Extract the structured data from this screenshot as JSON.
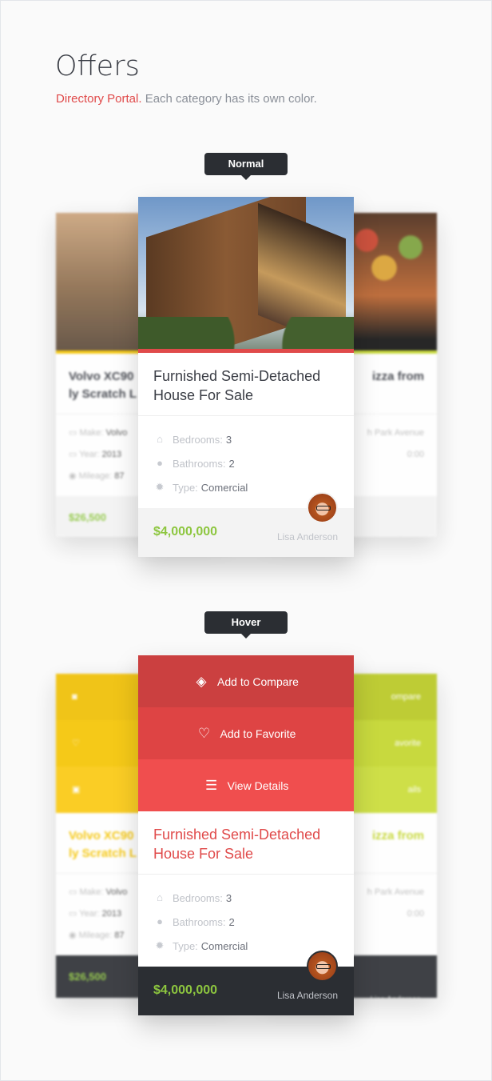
{
  "header": {
    "title": "Offers",
    "subtitle_accent": "Directory Portal.",
    "subtitle_rest": " Each category has its own color."
  },
  "states": {
    "normal": "Normal",
    "hover": "Hover"
  },
  "colors": {
    "real_estate": "#e04a4a",
    "cars": "#f5c400",
    "food": "#c3d62a",
    "price": "#8dc63f",
    "dark": "#2b2e33"
  },
  "left_card": {
    "title_line1": "Volvo XC90",
    "title_line2": "ly Scratch L",
    "features": [
      {
        "label": "Make:",
        "value": "Volvo"
      },
      {
        "label": "Year:",
        "value": "2013"
      },
      {
        "label": "Mileage:",
        "value": "87"
      }
    ],
    "price": "$26,500"
  },
  "right_card": {
    "title": "izza from",
    "features": [
      {
        "value": "h Park Avenue"
      },
      {
        "value": "0:00"
      }
    ],
    "author": "Lisa Anderson",
    "hover_actions": [
      "ompare",
      "avorite",
      "ails"
    ]
  },
  "main_card": {
    "title": "Furnished Semi-Detached House For Sale",
    "features": [
      {
        "icon": "home-icon",
        "label": "Bedrooms:",
        "value": "3"
      },
      {
        "icon": "drop-icon",
        "label": "Bathrooms:",
        "value": "2"
      },
      {
        "icon": "gear-icon",
        "label": "Type:",
        "value": "Comercial"
      }
    ],
    "price": "$4,000,000",
    "author": "Lisa Anderson",
    "hover_actions": [
      {
        "icon": "layers-icon",
        "label": "Add to Compare"
      },
      {
        "icon": "heart-icon",
        "label": "Add to Favorite"
      },
      {
        "icon": "list-icon",
        "label": "View Details"
      }
    ]
  }
}
